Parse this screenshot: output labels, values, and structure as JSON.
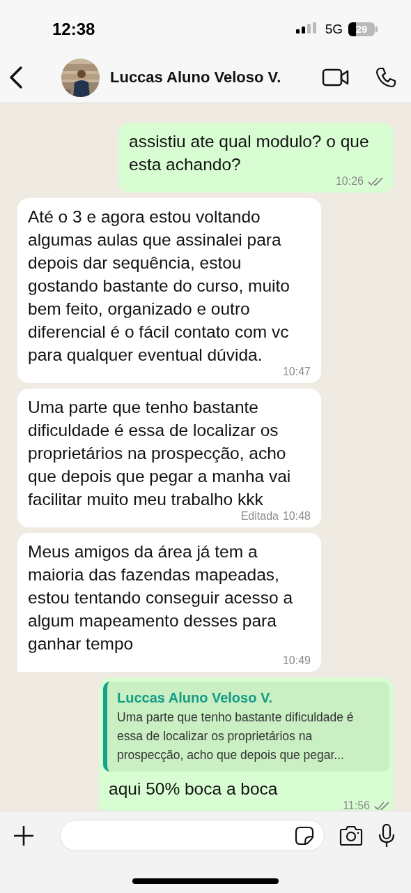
{
  "status_bar": {
    "time": "12:38",
    "network": "5G",
    "battery": "29"
  },
  "header": {
    "contact_name": "Luccas Aluno Veloso V."
  },
  "messages": [
    {
      "outgoing": true,
      "text": "assistiu ate qual modulo? o que esta achando?",
      "time": "10:26",
      "read": false
    },
    {
      "outgoing": false,
      "text": "Até o 3 e agora estou voltando algumas aulas que assinalei para depois dar sequência, estou gostando bastante do curso, muito bem feito, organizado e outro diferencial é o fácil contato com vc para qualquer eventual dúvida.",
      "time": "10:47"
    },
    {
      "outgoing": false,
      "text": "Uma parte que tenho bastante dificuldade é essa de localizar os proprietários na prospecção, acho que depois que pegar a manha vai facilitar muito meu trabalho kkk",
      "time": "10:48",
      "edited_label": "Editada"
    },
    {
      "outgoing": false,
      "text": "Meus amigos da área já tem a maioria das fazendas mapeadas, estou tentando conseguir acesso a algum mapeamento desses para ganhar tempo",
      "time": "10:49",
      "tail": true
    },
    {
      "outgoing": true,
      "reply_to": {
        "author": "Luccas Aluno Veloso V.",
        "text": "Uma parte que tenho bastante dificuldade é essa de localizar os proprietários na prospecção, acho que depois que pegar..."
      },
      "text": "aqui 50% boca a boca",
      "time": "11:56",
      "read": false
    }
  ]
}
